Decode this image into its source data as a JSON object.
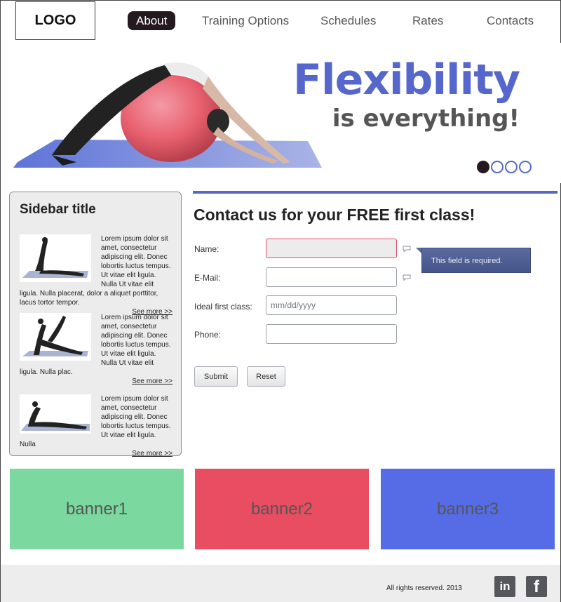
{
  "header": {
    "logo": "LOGO",
    "nav": [
      {
        "label": "About",
        "active": true
      },
      {
        "label": "Training Options",
        "active": false
      },
      {
        "label": "Schedules",
        "active": false
      },
      {
        "label": "Rates",
        "active": false
      },
      {
        "label": "Contacts",
        "active": false
      }
    ]
  },
  "hero": {
    "title": "Flexibility",
    "subtitle": "is everything!",
    "slide_count": 4,
    "active_slide": 1
  },
  "sidebar": {
    "title": "Sidebar title",
    "items": [
      {
        "text": "Lorem ipsum dolor sit amet, consectetur adipiscing elit. Donec lobortis luctus tempus. Ut vitae elit ligula. Nulla Ut vitae elit ligula. Nulla placerat, dolor a aliquet porttitor, lacus tortor tempor.",
        "more": "See more >>"
      },
      {
        "text": "Lorem ipsum dolor sit amet, consectetur adipiscing elit. Donec lobortis luctus tempus. Ut vitae elit ligula. Nulla Ut vitae elit ligula. Nulla plac.",
        "more": "See more >>"
      },
      {
        "text": "Lorem ipsum dolor sit amet, consectetur adipiscing elit. Donec lobortis luctus tempus. Ut vitae elit ligula. Nulla",
        "more": "See more >>"
      }
    ]
  },
  "contact": {
    "title": "Contact us for your FREE first class!",
    "fields": {
      "name_label": "Name:",
      "email_label": "E-Mail:",
      "date_label": "Ideal first class:",
      "date_placeholder": "mm/dd/yyyy",
      "phone_label": "Phone:"
    },
    "error_tooltip": "This field is required.",
    "submit_label": "Submit",
    "reset_label": "Reset"
  },
  "banners": [
    {
      "label": "banner1",
      "color": "#7bd89f"
    },
    {
      "label": "banner2",
      "color": "#e84d61"
    },
    {
      "label": "banner3",
      "color": "#566be6"
    }
  ],
  "footer": {
    "copyright": "All rights reserved. 2013",
    "social": [
      {
        "icon": "linkedin-icon",
        "glyph": "in"
      },
      {
        "icon": "facebook-icon",
        "glyph": "f"
      }
    ]
  },
  "colors": {
    "accent": "#5566cc",
    "nav_active": "#23191f",
    "error_border": "#e05066"
  }
}
